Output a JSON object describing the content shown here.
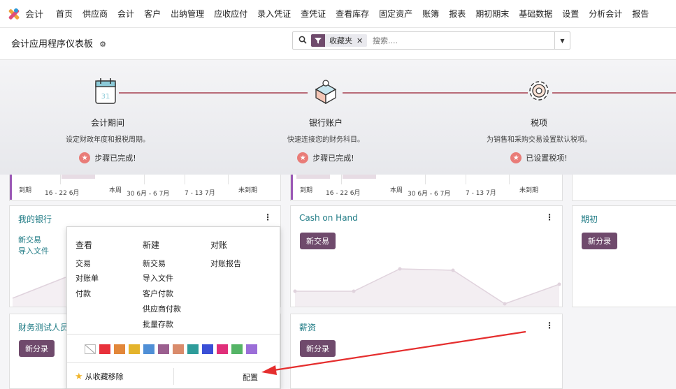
{
  "app": {
    "name": "会计"
  },
  "nav": [
    "首页",
    "供应商",
    "会计",
    "客户",
    "出纳管理",
    "应收应付",
    "录入凭证",
    "查凭证",
    "查看库存",
    "固定资产",
    "账簿",
    "报表",
    "期初期末",
    "基础数据",
    "设置",
    "分析会计",
    "报告"
  ],
  "breadcrumb": "会计应用程序仪表板",
  "search": {
    "facet": "收藏夹",
    "placeholder": "搜索....",
    "remove": "✕"
  },
  "onboarding": [
    {
      "title": "会计期间",
      "desc": "设定财政年度和报税周期。",
      "status": "步骤已完成!"
    },
    {
      "title": "银行账户",
      "desc": "快速连接您的财务科目。",
      "status": "步骤已完成!"
    },
    {
      "title": "税项",
      "desc": "为销售和采购交易设置默认税项。",
      "status": "已设置税项!"
    }
  ],
  "chart_ticks": [
    "到期",
    "16 - 22 6月",
    "本周",
    "30 6月 - 6 7月",
    "7 - 13 7月",
    "未到期"
  ],
  "cards": {
    "my_bank": {
      "title": "我的银行",
      "link1": "新交易",
      "link2": "导入文件"
    },
    "cash": {
      "title": "Cash on Hand",
      "button": "新交易"
    },
    "opening": {
      "title": "期初",
      "button": "新分录"
    },
    "finance_test": {
      "title": "财务测试人员",
      "button": "新分录"
    },
    "salary": {
      "title": "薪资",
      "button": "新分录"
    }
  },
  "dropdown": {
    "view": {
      "head": "查看",
      "items": [
        "交易",
        "对账单",
        "付款"
      ]
    },
    "new": {
      "head": "新建",
      "items": [
        "新交易",
        "导入文件",
        "客户付款",
        "供应商付款",
        "批量存款"
      ]
    },
    "reconcile": {
      "head": "对账",
      "items": [
        "对账报告"
      ]
    },
    "colors": [
      "#ffffff",
      "#e8313b",
      "#e2873a",
      "#e4b42c",
      "#4f8fd6",
      "#9b5f8f",
      "#d98b6b",
      "#2e9c9a",
      "#3a4fd6",
      "#e02f7a",
      "#55b466",
      "#9b6ed8"
    ],
    "remove_favorite": "从收藏移除",
    "configure": "配置"
  },
  "colors": {
    "brand": "#6f4a6c",
    "title": "#1f7b85",
    "arrow": "#e52e2e"
  }
}
